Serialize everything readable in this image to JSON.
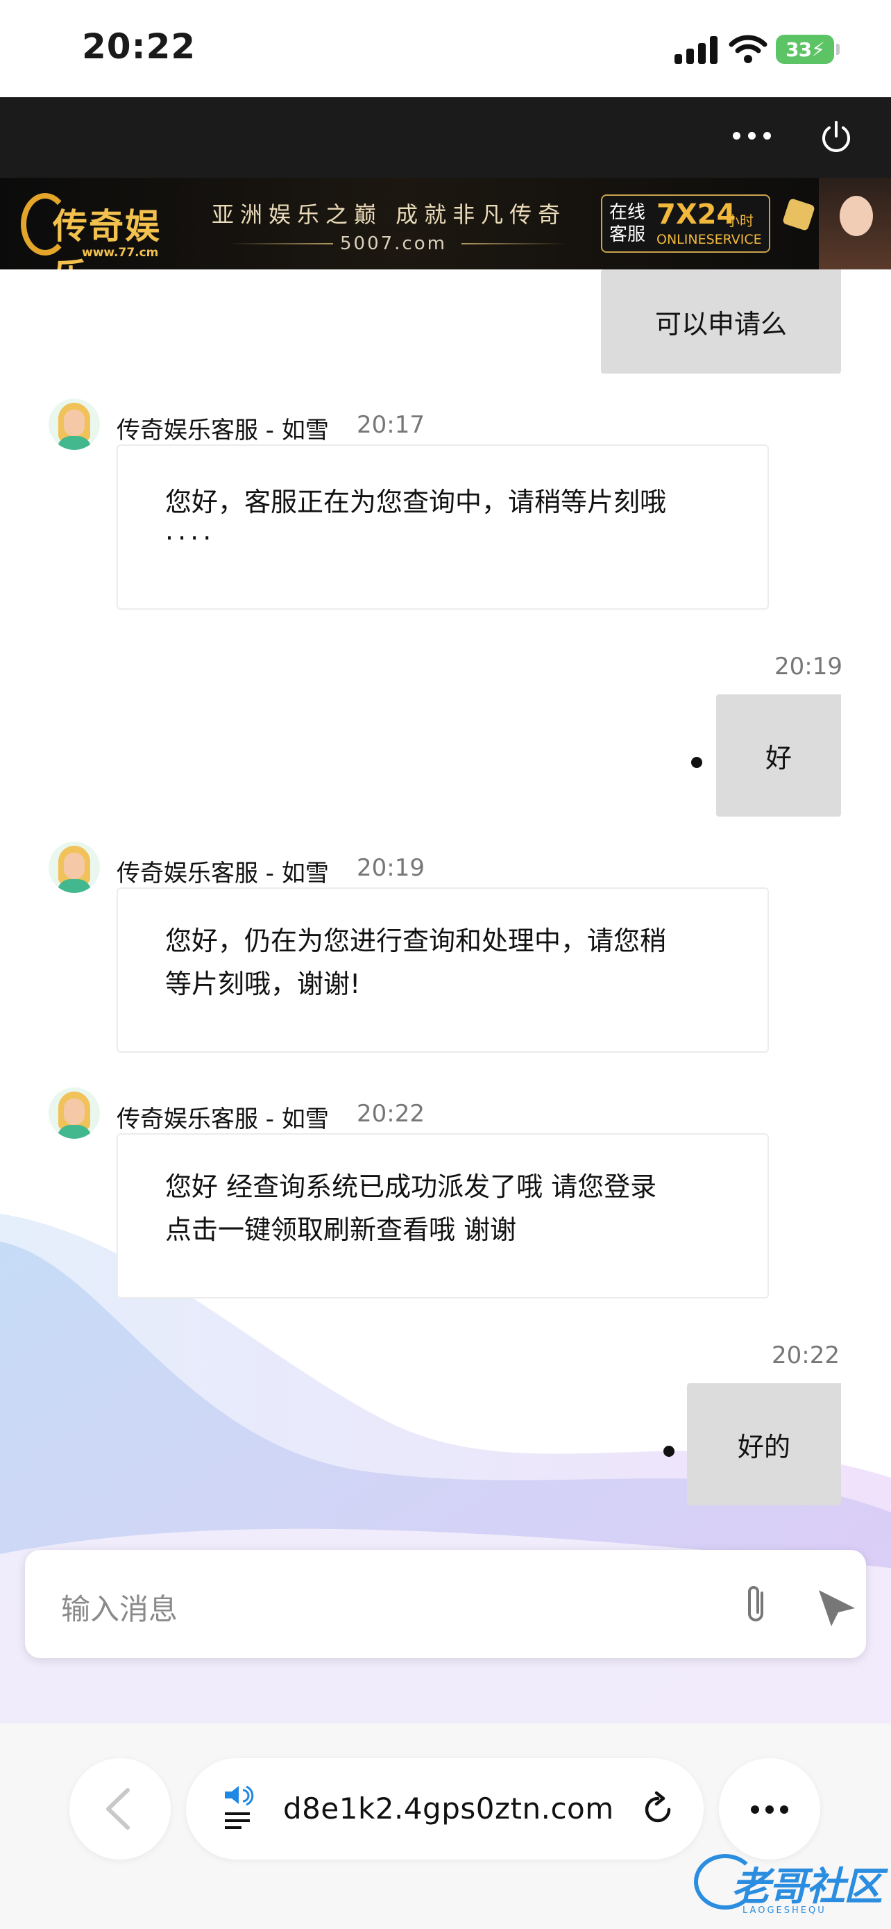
{
  "status_bar": {
    "time": "20:22",
    "battery": "33"
  },
  "top_bar": {
    "more_icon": "ellipsis-icon",
    "power_icon": "power-icon"
  },
  "banner": {
    "logo_text": "传奇娱乐",
    "logo_url": "www.77.cm",
    "slogan": "亚洲娱乐之巅  成就非凡传奇",
    "domain": "5007.com",
    "service_line1": "在线",
    "service_line2": "客服",
    "service_hours": "7X24",
    "service_hours_unit": "小时",
    "service_en": "ONLINESERVICE"
  },
  "messages": [
    {
      "type": "user",
      "text": "可以申请么"
    },
    {
      "type": "agent",
      "name": "传奇娱乐客服 - 如雪",
      "time": "20:17",
      "text": "您好，客服正在为您查询中，请稍等片刻哦....",
      "line1": "您好，客服正在为您查询中，请稍等片刻哦",
      "line2": "...."
    },
    {
      "type": "user",
      "time": "20:19",
      "text": "好"
    },
    {
      "type": "agent",
      "name": "传奇娱乐客服 - 如雪",
      "time": "20:19",
      "text": "您好，仍在为您进行查询和处理中，请您稍等片刻哦，谢谢!",
      "line1": "您好，仍在为您进行查询和处理中，请您稍",
      "line2": "等片刻哦，谢谢!"
    },
    {
      "type": "agent",
      "name": "传奇娱乐客服 - 如雪",
      "time": "20:22",
      "text": "您好 经查询系统已成功派发了哦 请您登录点击一键领取刷新查看哦 谢谢",
      "line1": "您好 经查询系统已成功派发了哦 请您登录",
      "line2": "点击一键领取刷新查看哦 谢谢"
    },
    {
      "type": "user",
      "time": "20:22",
      "text": "好的"
    }
  ],
  "input": {
    "placeholder": "输入消息",
    "attach_icon": "paperclip-icon",
    "send_icon": "send-icon"
  },
  "browser": {
    "url": "d8e1k2.4gps0ztn.com",
    "back_icon": "chevron-left-icon",
    "reload_icon": "reload-icon",
    "speaker_icon": "speaker-icon",
    "more_icon": "ellipsis-icon"
  },
  "watermark": {
    "text": "老哥社区",
    "sub": "LAOGESHEQU"
  },
  "colors": {
    "topbar": "#1b1b1b",
    "user_bubble": "#dcdcdc",
    "banner_gold": "#f1b83b",
    "watermark_blue": "#2b8de0"
  }
}
